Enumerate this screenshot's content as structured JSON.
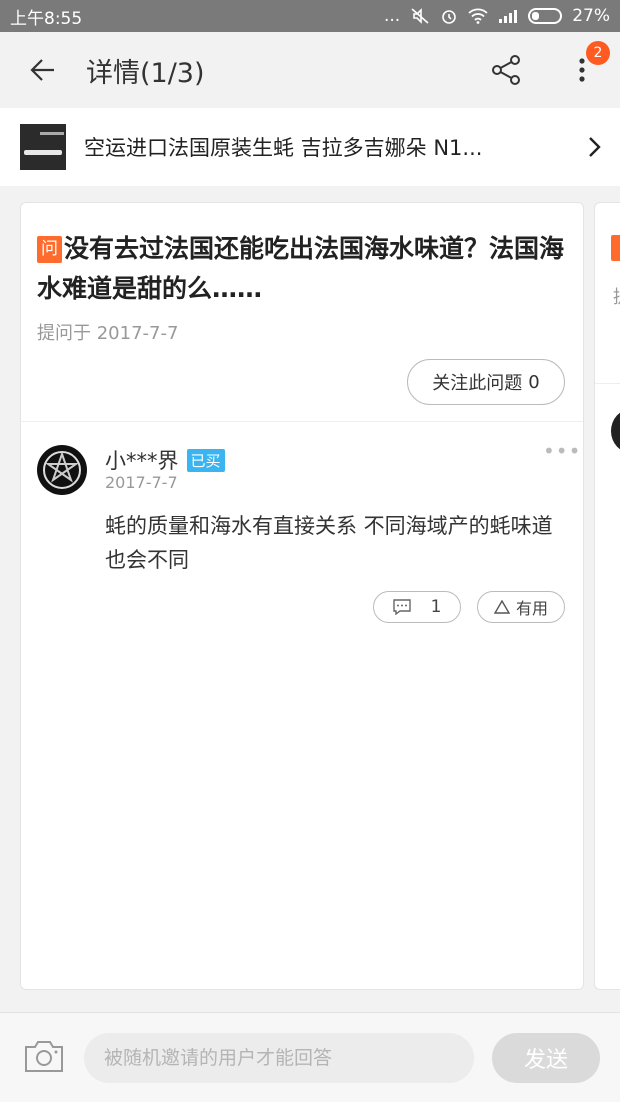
{
  "status_bar": {
    "time": "上午8:55",
    "dots": "...",
    "battery": "27%"
  },
  "header": {
    "title": "详情(1/3)",
    "badge": "2"
  },
  "product": {
    "name": "空运进口法国原装生蚝 吉拉多吉娜朵 N1..."
  },
  "question": {
    "tag": "问",
    "text": "没有去过法国还能吃出法国海水味道？法国海水难道是甜的么……",
    "asked": "提问于 2017-7-7",
    "follow_label": "关注此问题",
    "follow_count": "0"
  },
  "answer": {
    "user": "小***界",
    "bought_tag": "已买",
    "date": "2017-7-7",
    "text": "蚝的质量和海水有直接关系 不同海域产的蚝味道也会不同",
    "comment_count": "1",
    "useful_label": "有用",
    "more": "•••"
  },
  "peek": {
    "tag": "",
    "text": "提"
  },
  "bottom": {
    "placeholder": "被随机邀请的用户才能回答",
    "send_label": "发送"
  },
  "colors": {
    "accent": "#ff6b2c",
    "badge": "#ff5a1f",
    "bought": "#3bb4f2"
  }
}
